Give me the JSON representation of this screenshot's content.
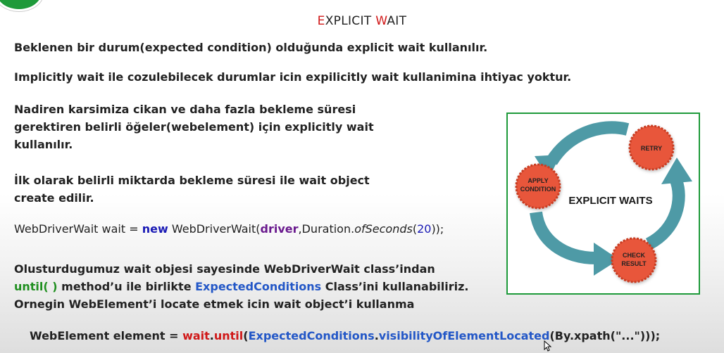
{
  "title": {
    "p1_red": "E",
    "p1": "XPLICIT ",
    "p2_red": "W",
    "p2": "AIT"
  },
  "lines": {
    "l1": "Beklenen bir durum(expected condition) olduğunda explicit wait kullanılır.",
    "l2": "Implicitly wait ile cozulebilecek durumlar icin expilicitly wait kullanimina ihtiyac yoktur."
  },
  "para1": [
    "Nadiren karsimiza cikan ve daha fazla bekleme süresi",
    "gerektiren belirli öğeler(webelement) için explicitly wait",
    "kullanılır."
  ],
  "para2": [
    "İlk olarak belirli miktarda bekleme süresi ile wait object",
    "create edilir."
  ],
  "code1": {
    "a": "WebDriverWait wait = ",
    "new": "new",
    "b": " WebDriverWait(",
    "driver": "driver",
    "c": ",Duration.",
    "method": "ofSeconds",
    "d": "(",
    "num": "20",
    "e": "));"
  },
  "para3": {
    "line1": "Olusturdugumuz wait objesi sayesinde WebDriverWait class’indan",
    "until": "until( )",
    "mid": " method’u ile birlikte ",
    "ec": "ExpectedConditions",
    "end": " Class’ini kullanabiliriz.",
    "line3": "Ornegin WebElement’i locate etmek icin wait object’i kullanma"
  },
  "code2": {
    "a": "WebElement element = ",
    "wait": "wait",
    "dot": ".",
    "until": "until",
    "p1": "(",
    "ec": "ExpectedConditions",
    "dot2": ".",
    "vis": "visibilityOfElementLocated",
    "p2": "(By.xpath(\"...\")));"
  },
  "diagram": {
    "center": "EXPLICIT WAITS",
    "retry": "RETRY",
    "apply1": "APPLY",
    "apply2": "CONDITION",
    "check1": "CHECK",
    "check2": "RESULT"
  },
  "colors": {
    "title_red": "#d01818",
    "green": "#1f8f1f",
    "blue": "#2357c7",
    "arrow": "#4e9aa6",
    "badge": "#e8563a",
    "border": "#1e9a3a"
  }
}
